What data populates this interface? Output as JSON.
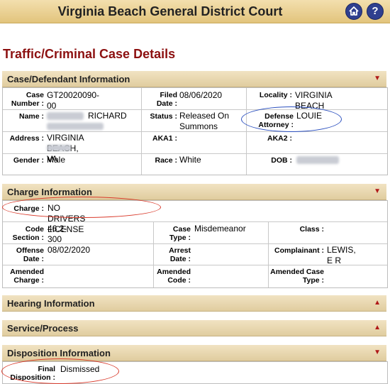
{
  "header": {
    "title": "Virginia Beach General District Court",
    "home_icon": "home-icon",
    "help_icon": "help-icon",
    "help_glyph": "?"
  },
  "page_title": "Traffic/Criminal Case Details",
  "sections": {
    "case": {
      "title": "Case/Defendant Information",
      "case_number_label": "Case Number :",
      "case_number": "GT20020090-00",
      "filed_date_label": "Filed Date :",
      "filed_date": "08/06/2020",
      "locality_label": "Locality :",
      "locality": "VIRGINIA BEACH",
      "name_label": "Name :",
      "name_visible": "RICHARD",
      "status_label": "Status :",
      "status": "Released On Summons",
      "defense_attorney_label": "Defense Attorney :",
      "defense_attorney": "LOUIE",
      "address_label": "Address :",
      "address": "VIRGINIA BEACH, VA",
      "aka1_label": "AKA1 :",
      "aka2_label": "AKA2 :",
      "gender_label": "Gender :",
      "gender": "Male",
      "race_label": "Race :",
      "race": "White",
      "dob_label": "DOB :"
    },
    "charge": {
      "title": "Charge Information",
      "charge_label": "Charge :",
      "charge": "NO DRIVERS LICENSE",
      "code_section_label": "Code Section :",
      "code_section": "46.2-300",
      "case_type_label": "Case Type :",
      "case_type": "Misdemeanor",
      "class_label": "Class :",
      "offense_date_label": "Offense Date :",
      "offense_date": "08/02/2020",
      "arrest_date_label": "Arrest Date :",
      "complainant_label": "Complainant :",
      "complainant": "LEWIS, E R",
      "amended_charge_label": "Amended Charge :",
      "amended_code_label": "Amended Code :",
      "amended_case_type_label": "Amended Case Type :"
    },
    "hearing": {
      "title": "Hearing Information"
    },
    "service": {
      "title": "Service/Process"
    },
    "disposition": {
      "title": "Disposition Information",
      "final_disposition_label": "Final Disposition :",
      "final_disposition": "Dismissed"
    }
  },
  "icons": {
    "expanded_arrow": "▼",
    "collapsed_arrow": "▲"
  },
  "colors": {
    "heading": "#8c1010",
    "section_bg": "#ecdcb4",
    "annotation_red": "#d93a2b",
    "annotation_blue": "#2a4fbf"
  }
}
